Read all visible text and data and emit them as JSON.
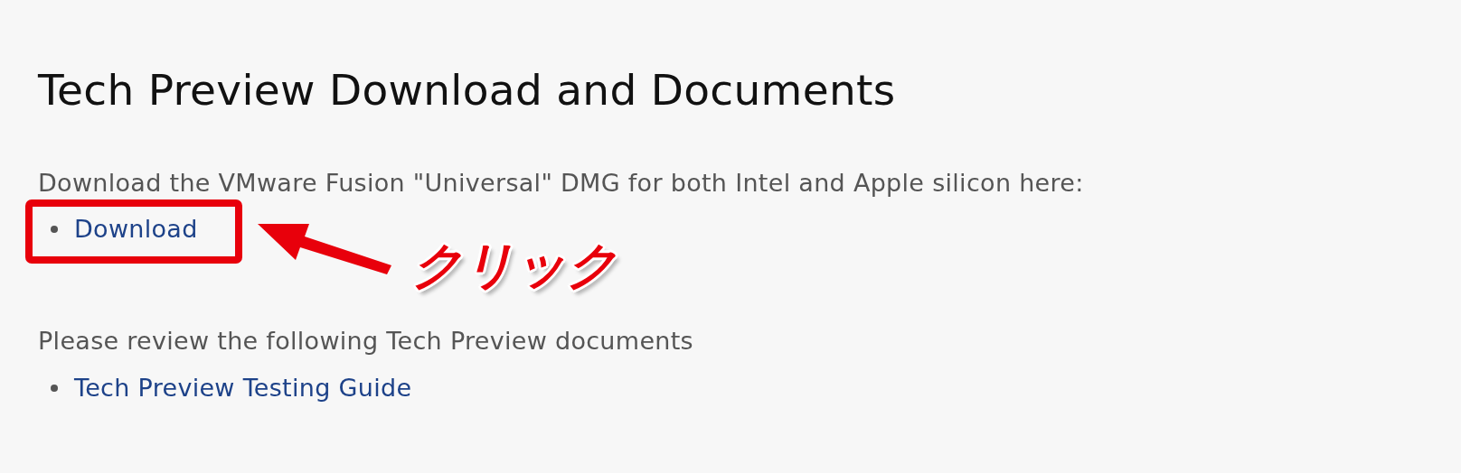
{
  "heading": "Tech Preview Download and Documents",
  "sections": [
    {
      "intro": "Download the VMware Fusion \"Universal\" DMG for both Intel and Apple silicon here:",
      "links": [
        "Download"
      ]
    },
    {
      "intro": "Please review the following Tech Preview documents",
      "links": [
        "Tech Preview Testing Guide"
      ]
    }
  ],
  "annotation": {
    "label": "クリック"
  }
}
